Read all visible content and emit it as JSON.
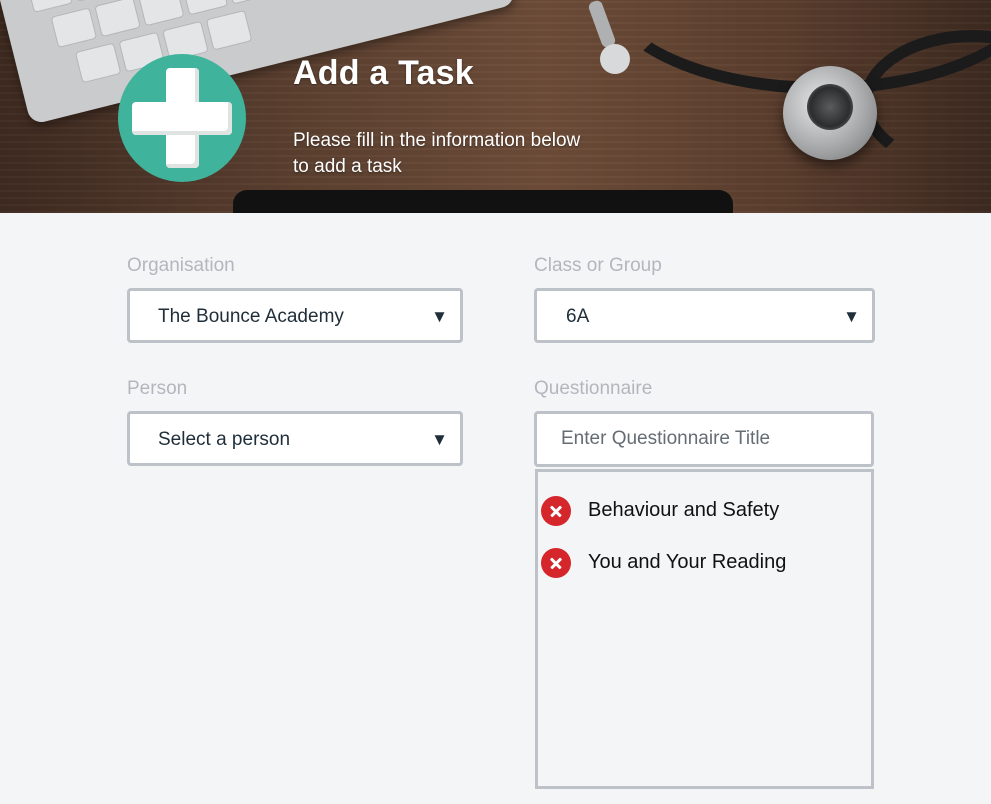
{
  "header": {
    "title": "Add a Task",
    "subtitle_line1": "Please fill in the information below",
    "subtitle_line2": "to add a task",
    "icon": "plus-icon",
    "accent_color": "#3fb39b"
  },
  "form": {
    "organisation": {
      "label": "Organisation",
      "value": "The Bounce Academy"
    },
    "class_group": {
      "label": "Class or Group",
      "value": "6A"
    },
    "person": {
      "label": "Person",
      "value": "Select a person"
    },
    "questionnaire": {
      "label": "Questionnaire",
      "placeholder": "Enter Questionnaire Title",
      "items": [
        {
          "label": "Behaviour and Safety",
          "icon": "remove-icon"
        },
        {
          "label": "You and Your Reading",
          "icon": "remove-icon"
        }
      ]
    },
    "dropdown_caret": "▼"
  }
}
